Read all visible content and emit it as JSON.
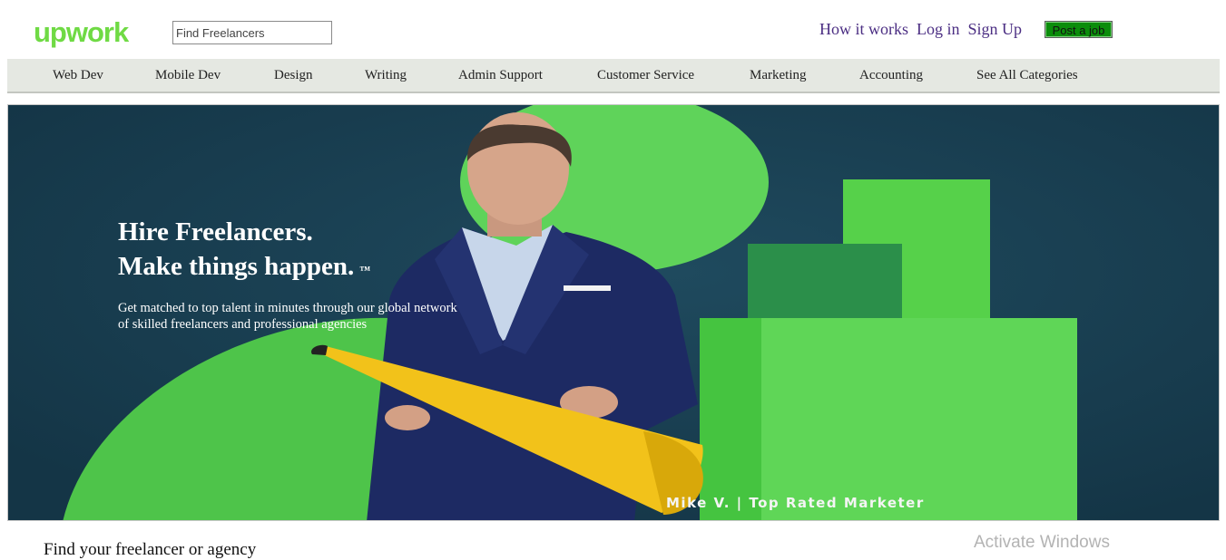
{
  "header": {
    "logo_text": "upwork",
    "search_placeholder": "Find Freelancers",
    "links": [
      "How it works",
      "Log in",
      "Sign Up"
    ],
    "post_job_label": "Post a job"
  },
  "nav": {
    "items": [
      "Web Dev",
      "Mobile Dev",
      "Design",
      "Writing",
      "Admin Support",
      "Customer Service",
      "Marketing",
      "Accounting",
      "See All Categories"
    ]
  },
  "hero": {
    "title_line1": "Hire Freelancers.",
    "title_line2": "Make things happen.",
    "trademark": "™",
    "subtitle": "Get matched to top talent in minutes through our global network of skilled freelancers and professional agencies",
    "caption": "Mike V. | Top Rated Marketer"
  },
  "main": {
    "find_heading": "Find your freelancer or agency"
  },
  "overlay": {
    "activate_windows": "Activate Windows"
  },
  "colors": {
    "brand_green": "#6fda44",
    "post_job_bg": "#0b8d0b",
    "link_purple": "#4b2e83",
    "nav_bg": "#e5e8e2",
    "hero_bg": "#183e52"
  }
}
